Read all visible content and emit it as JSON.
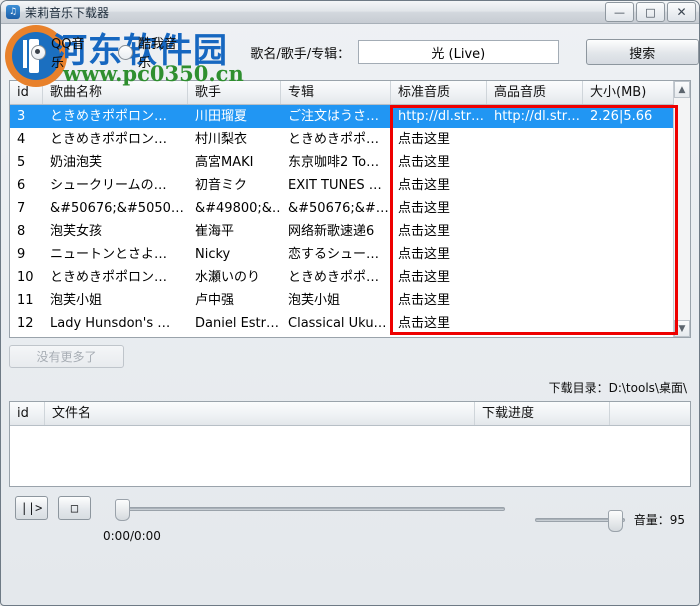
{
  "window": {
    "title": "茉莉音乐下载器",
    "icon": "music-note-icon",
    "minimize_label": "—",
    "maximize_label": "□",
    "close_label": "✕"
  },
  "watermark": {
    "site_name": "河东软件园",
    "site_url": "www.pc0350.cn"
  },
  "source": {
    "options": [
      {
        "label": "QQ音乐",
        "checked": true
      },
      {
        "label": "酷我音乐",
        "checked": false
      }
    ]
  },
  "search": {
    "label": "歌名/歌手/专辑：",
    "value": "光 (Live)",
    "placeholder": "",
    "button_label": "搜索"
  },
  "results": {
    "columns": [
      "id",
      "歌曲名称",
      "歌手",
      "专辑",
      "标准音质",
      "高品音质",
      "大小(MB)"
    ],
    "rows": [
      {
        "id": "3",
        "name": "ときめきポポロン…",
        "artist": "川田瑠夏",
        "album": "ご注文はうさ…",
        "std": "http://dl.str…",
        "hq": "http://dl.str…",
        "size": "2.26|5.66",
        "selected": true
      },
      {
        "id": "4",
        "name": "ときめきポポロン…",
        "artist": "村川梨衣",
        "album": "ときめきポポ…",
        "std": "点击这里",
        "hq": "",
        "size": "",
        "selected": false
      },
      {
        "id": "5",
        "name": "奶油泡芙",
        "artist": "高宮MAKI",
        "album": "东京咖啡2 To…",
        "std": "点击这里",
        "hq": "",
        "size": "",
        "selected": false
      },
      {
        "id": "6",
        "name": "シュークリームの…",
        "artist": "初音ミク",
        "album": "EXIT TUNES …",
        "std": "点击这里",
        "hq": "",
        "size": "",
        "selected": false
      },
      {
        "id": "7",
        "name": "&#50676;&#5050…",
        "artist": "&#49800;&…",
        "album": "&#50676;&#…",
        "std": "点击这里",
        "hq": "",
        "size": "",
        "selected": false
      },
      {
        "id": "8",
        "name": "泡芙女孩",
        "artist": "崔海平",
        "album": "网络新歌速递6",
        "std": "点击这里",
        "hq": "",
        "size": "",
        "selected": false
      },
      {
        "id": "9",
        "name": "ニュートンとさよ…",
        "artist": "Nicky",
        "album": "恋するシュー…",
        "std": "点击这里",
        "hq": "",
        "size": "",
        "selected": false
      },
      {
        "id": "10",
        "name": "ときめきポポロン…",
        "artist": "水瀬いのり",
        "album": "ときめきポポ…",
        "std": "点击这里",
        "hq": "",
        "size": "",
        "selected": false
      },
      {
        "id": "11",
        "name": "泡芙小姐",
        "artist": "卢中强",
        "album": "泡芙小姐",
        "std": "点击这里",
        "hq": "",
        "size": "",
        "selected": false
      },
      {
        "id": "12",
        "name": "Lady Hunsdon's …",
        "artist": "Daniel Estr…",
        "album": "Classical Uku…",
        "std": "点击这里",
        "hq": "",
        "size": "",
        "selected": false
      }
    ],
    "scroll_up_icon": "chevron-up-icon",
    "scroll_down_icon": "chevron-down-icon"
  },
  "load_more": {
    "label": "没有更多了",
    "enabled": false
  },
  "download_dir": {
    "text": "下载目录：D:\\tools\\桌面\\"
  },
  "downloads": {
    "columns": [
      "id",
      "文件名",
      "下载进度",
      ""
    ],
    "rows": []
  },
  "player": {
    "play_label": "||>",
    "stop_label": "□",
    "time": "0:00/0:00",
    "seek_percent": 0,
    "volume_label": "音量：95",
    "volume_percent": 95
  },
  "colors": {
    "selection": "#2196f3",
    "annotation": "#ee0000",
    "watermark_blue": "#1667c0",
    "watermark_green": "#2f8f2f"
  }
}
